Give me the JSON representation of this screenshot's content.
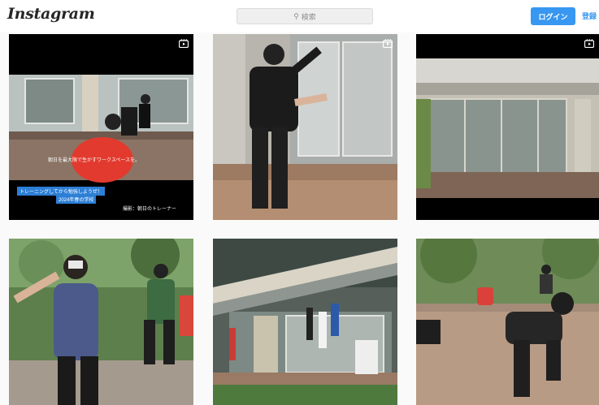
{
  "header": {
    "logo": "Instagram",
    "search_placeholder": "検索",
    "login_label": "ログイン",
    "signup_label": "登録"
  },
  "posts": [
    {
      "type": "video",
      "icon": "video-icon",
      "caption": "朝日を最大限で生かすワークスペースを。",
      "subtitle": "トレーニングしてから勉強しようぜ！",
      "subtitle2": "2024年春の学校",
      "credit": "撮影：朝日のトレーナー"
    },
    {
      "type": "video",
      "icon": "video-icon"
    },
    {
      "type": "video",
      "icon": "video-icon"
    },
    {
      "type": "image"
    },
    {
      "type": "image"
    },
    {
      "type": "image"
    }
  ],
  "colors": {
    "accent": "#3897f0",
    "background": "#fafafa"
  }
}
